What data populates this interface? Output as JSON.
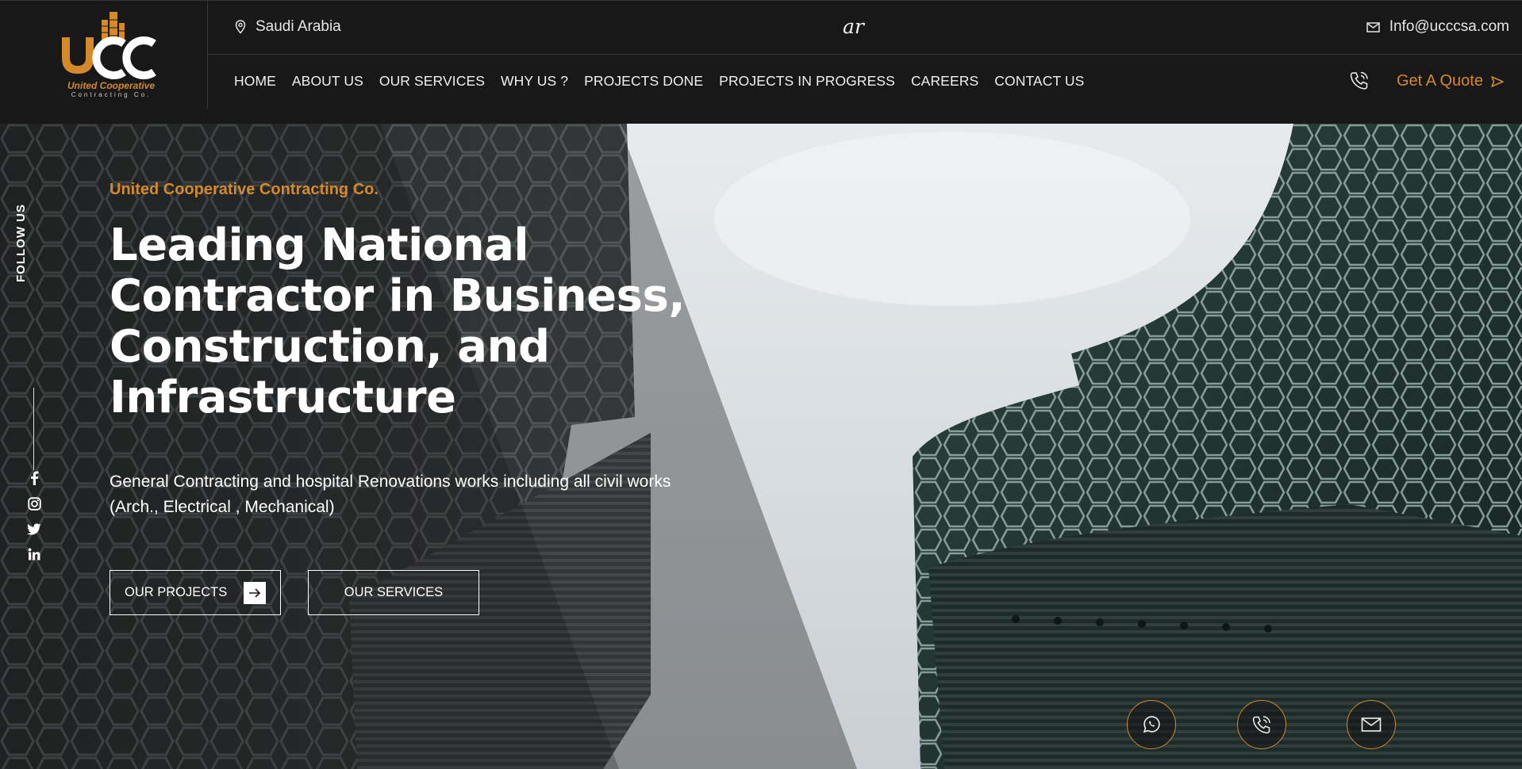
{
  "brand": {
    "logo_letters": "UCC",
    "name": "United Cooperative",
    "sub": "Contracting Co."
  },
  "topbar": {
    "location": "Saudi Arabia",
    "language": "ar",
    "email": "Info@ucccsa.com"
  },
  "nav": {
    "items": [
      "HOME",
      "ABOUT US",
      "OUR SERVICES",
      "WHY US ?",
      "PROJECTS DONE",
      "PROJECTS IN PROGRESS",
      "CAREERS",
      "CONTACT US"
    ],
    "quote_label": "Get A Quote"
  },
  "hero": {
    "eyebrow": "United Cooperative Contracting Co.",
    "headline_lines": [
      "Leading National",
      "Contractor in Business,",
      "Construction, and",
      "Infrastructure"
    ],
    "description": "General Contracting and hospital Renovations works including all civil works (Arch., Electrical , Mechanical)",
    "btn_projects": "OUR PROJECTS",
    "btn_services": "OUR SERVICES"
  },
  "social": {
    "label": "FOLLOW US",
    "icons": [
      "facebook-icon",
      "instagram-icon",
      "twitter-icon",
      "linkedin-icon"
    ]
  },
  "floating": {
    "icons": [
      "whatsapp-icon",
      "phone-icon",
      "mail-icon"
    ]
  },
  "colors": {
    "accent": "#d48a2a",
    "header_bg": "#181818",
    "sky": "#dfe4e8",
    "facade": "#203430"
  }
}
